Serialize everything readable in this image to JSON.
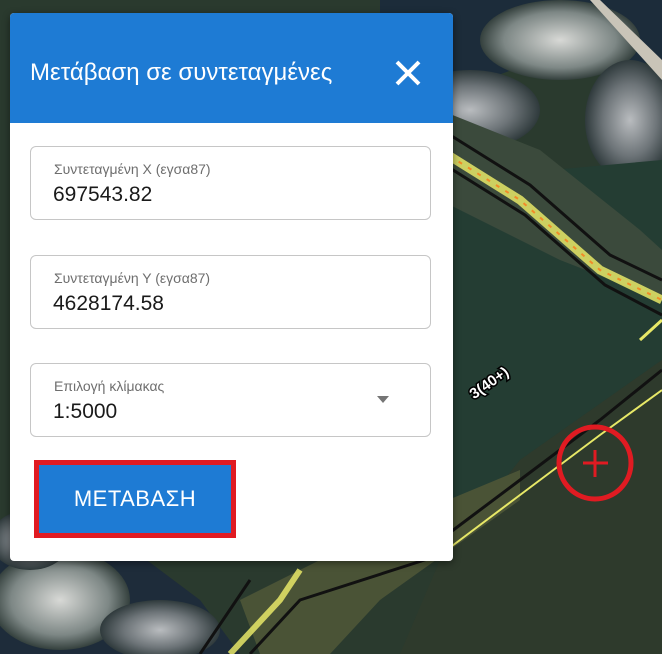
{
  "dialog": {
    "title": "Μετάβαση σε συντεταγμένες",
    "close_icon": "close-icon"
  },
  "fields": {
    "x": {
      "label": "Συντεταγμένη Χ (εγσα87)",
      "value": "697543.82"
    },
    "y": {
      "label": "Συντεταγμένη Υ (εγσα87)",
      "value": "4628174.58"
    },
    "scale": {
      "label": "Επιλογή κλίμακας",
      "value": "1:5000",
      "icon": "dropdown-arrow-icon"
    }
  },
  "goto_button": {
    "label": "ΜΕΤΑΒΑΣΗ"
  },
  "map": {
    "parcel_label": "3(40+)",
    "marker_icon": "target-marker-icon",
    "marker_color": "#e01b22"
  },
  "colors": {
    "accent": "#1e7bd4",
    "highlight": "#e01b22"
  }
}
